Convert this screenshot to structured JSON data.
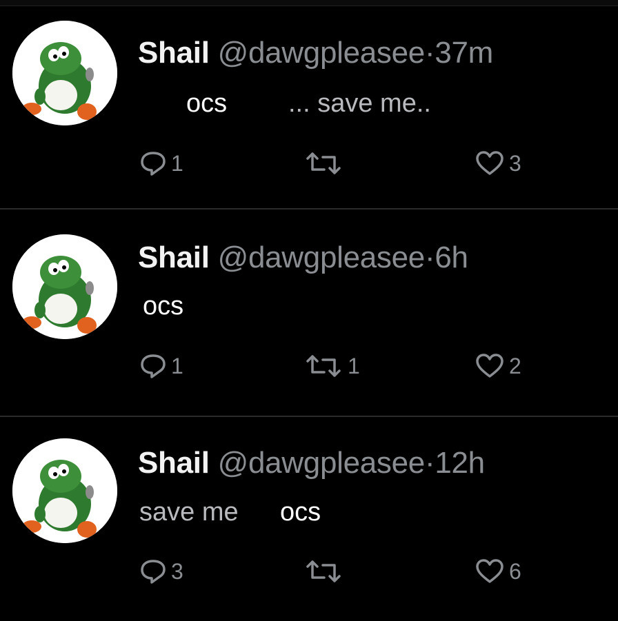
{
  "tweets": [
    {
      "name": "Shail",
      "handle": "@dawgpleasee",
      "separator": "·",
      "time": "37m",
      "text_parts": [
        "ocs",
        "... save me.."
      ],
      "replies": "1",
      "retweets": "",
      "likes": "3"
    },
    {
      "name": "Shail",
      "handle": "@dawgpleasee",
      "separator": "·",
      "time": "6h",
      "text_parts": [
        "ocs"
      ],
      "replies": "1",
      "retweets": "1",
      "likes": "2"
    },
    {
      "name": "Shail",
      "handle": "@dawgpleasee",
      "separator": "·",
      "time": "12h",
      "text_parts": [
        "save me",
        "ocs"
      ],
      "replies": "3",
      "retweets": "",
      "likes": "6"
    }
  ],
  "icons": {
    "reply": "reply-icon",
    "retweet": "retweet-icon",
    "like": "heart-icon",
    "avatar": "avatar-yoshi"
  },
  "colors": {
    "background": "#000000",
    "name": "#f2f2f2",
    "muted": "#8a8d91",
    "divider": "#2a2a2a"
  }
}
